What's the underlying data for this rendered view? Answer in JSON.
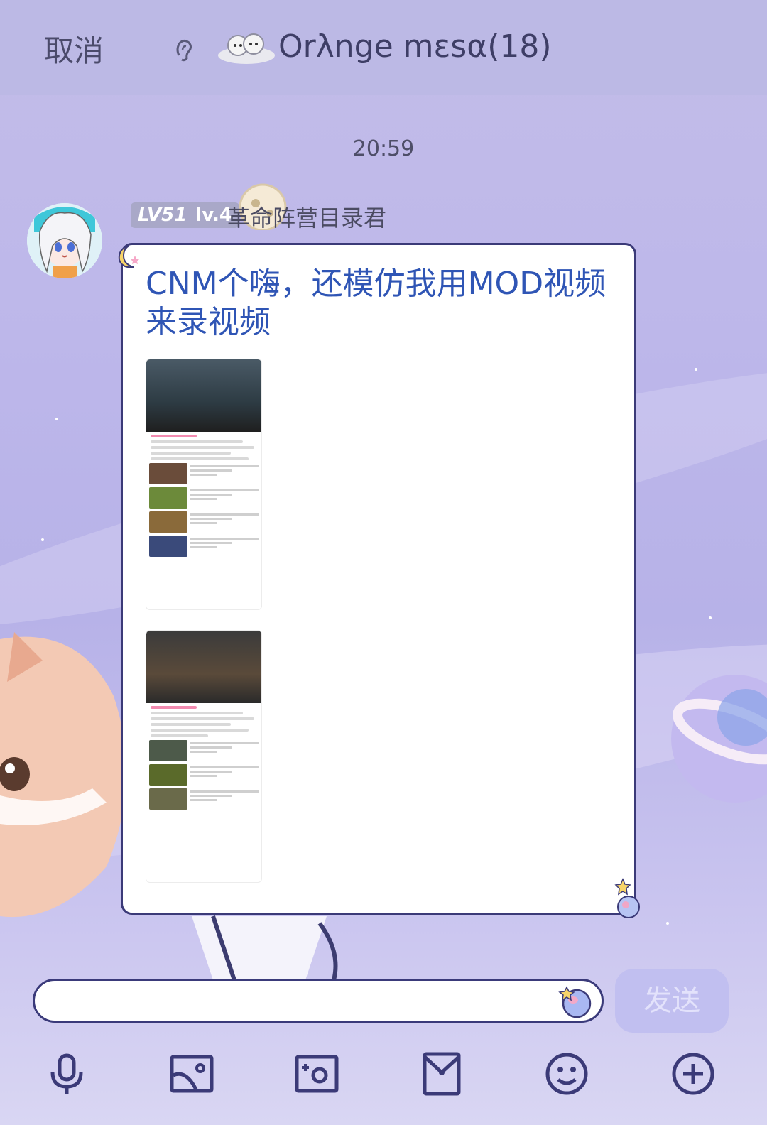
{
  "header": {
    "cancel_label": "取消",
    "group_title": "Orλnge mεsα(18)"
  },
  "timestamp": "20:59",
  "sender": {
    "badge_lv": "LV51",
    "badge_level": "lv.4",
    "name": "革命阵营目录君"
  },
  "message": {
    "text": "CNM个嗨，还模仿我用MOD视频来录视频"
  },
  "composer": {
    "input_value": "",
    "send_label": "发送"
  },
  "toolbar": {
    "items": [
      "mic-icon",
      "image-icon",
      "camera-icon",
      "envelope-icon",
      "emoji-icon",
      "plus-icon"
    ]
  },
  "colors": {
    "header_bg": "#bcb9e5",
    "text_blue": "#2f55b5",
    "bubble_border": "#3b3a78",
    "send_btn": "#c1bff0"
  }
}
